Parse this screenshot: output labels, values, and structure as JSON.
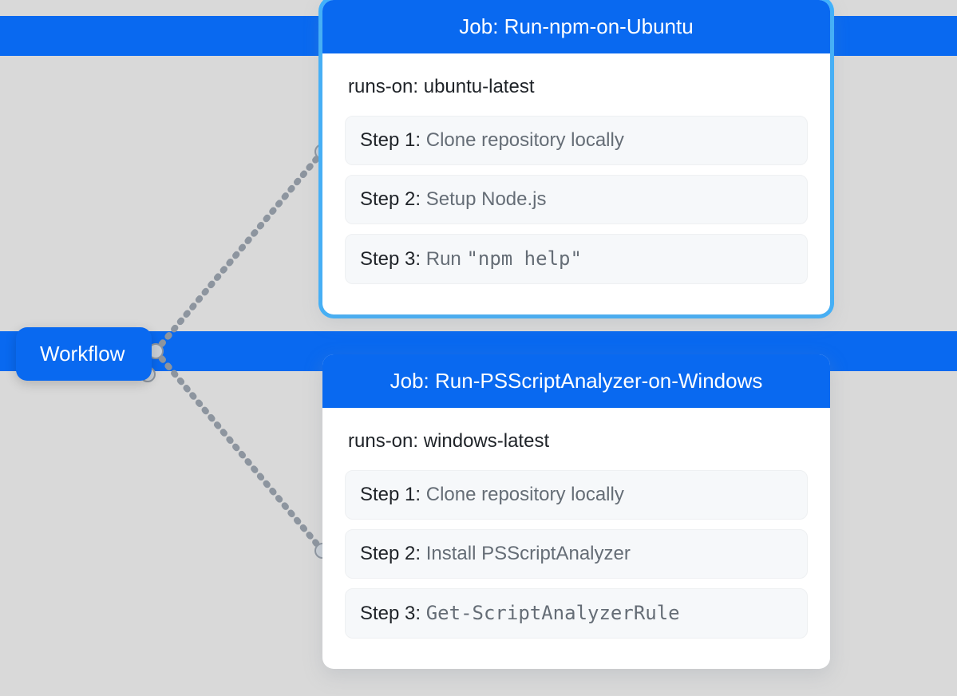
{
  "workflow": {
    "label": "Workflow"
  },
  "jobs": [
    {
      "header_prefix": "Job: ",
      "name": "Run-npm-on-Ubuntu",
      "runs_on_label": "runs-on: ",
      "runs_on_value": "ubuntu-latest",
      "steps": [
        {
          "label": "Step 1: ",
          "text": "Clone repository locally",
          "code": false
        },
        {
          "label": "Step 2: ",
          "text": "Setup Node.js",
          "code": false
        },
        {
          "label": "Step 3: ",
          "prefix": "Run ",
          "text": "\"npm help\"",
          "code": true
        }
      ]
    },
    {
      "header_prefix": "Job: ",
      "name": "Run-PSScriptAnalyzer-on-Windows",
      "runs_on_label": "runs-on: ",
      "runs_on_value": "windows-latest",
      "steps": [
        {
          "label": "Step 1: ",
          "text": "Clone repository locally",
          "code": false
        },
        {
          "label": "Step 2: ",
          "text": "Install PSScriptAnalyzer",
          "code": false
        },
        {
          "label": "Step 3: ",
          "text": "Get-ScriptAnalyzerRule",
          "code": true
        }
      ]
    }
  ]
}
